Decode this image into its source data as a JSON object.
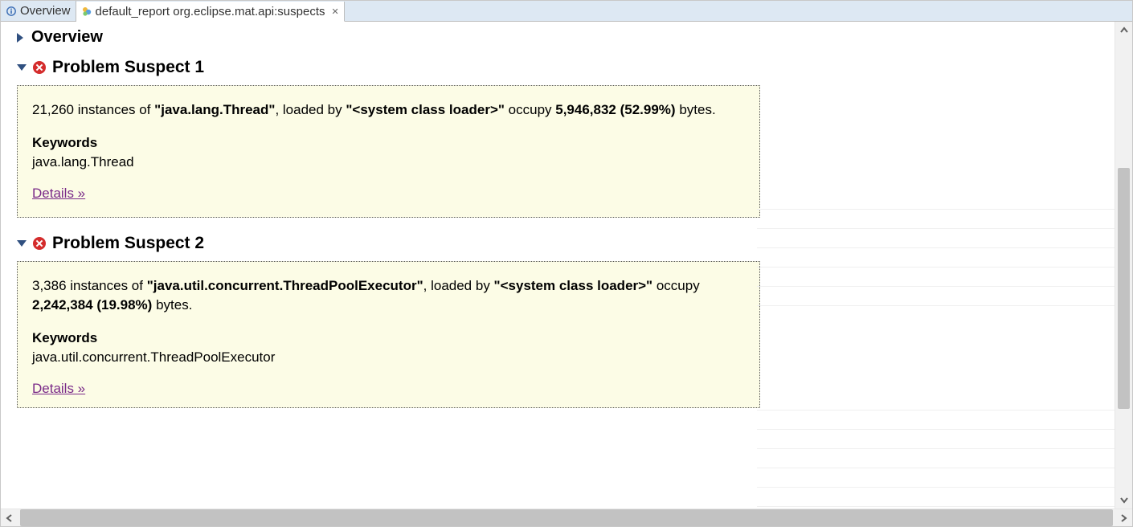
{
  "tabs": {
    "overview": "Overview",
    "report": "default_report  org.eclipse.mat.api:suspects"
  },
  "sections": {
    "overview_title": "Overview",
    "s1": {
      "title": "Problem Suspect 1",
      "line_pre": "21,260 instances of ",
      "class": "\"java.lang.Thread\"",
      "mid": ", loaded by ",
      "loader": "\"<system class loader>\"",
      "mid2": " occupy ",
      "bytes": "5,946,832 (52.99%)",
      "post": " bytes.",
      "kw_h": "Keywords",
      "kw": "java.lang.Thread",
      "details": "Details »"
    },
    "s2": {
      "title": "Problem Suspect 2",
      "line_pre": "3,386 instances of ",
      "class": "\"java.util.concurrent.ThreadPoolExecutor\"",
      "mid": ", loaded by ",
      "loader": "\"<system class loader>\"",
      "mid2": " occupy ",
      "bytes": "2,242,384 (19.98%)",
      "post": " bytes.",
      "kw_h": "Keywords",
      "kw": "java.util.concurrent.ThreadPoolExecutor",
      "details": "Details »"
    }
  }
}
